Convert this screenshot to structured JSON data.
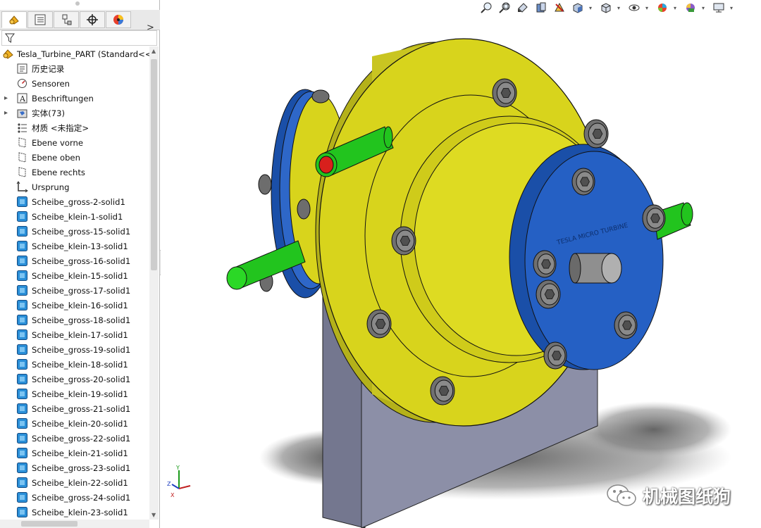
{
  "panel": {
    "tabs": [
      {
        "name": "feature-manager",
        "icon": "feature-tree-icon",
        "active": true
      },
      {
        "name": "property-manager",
        "icon": "property-list-icon",
        "active": false
      },
      {
        "name": "configuration-manager",
        "icon": "configuration-icon",
        "active": false
      },
      {
        "name": "dimxpert-manager",
        "icon": "crosshair-icon",
        "active": false
      },
      {
        "name": "display-manager",
        "icon": "appearance-icon",
        "active": false
      }
    ],
    "more_tabs_glyph": ">",
    "tree": {
      "root": {
        "label": "Tesla_Turbine_PART  (Standard<<"
      },
      "items": [
        {
          "label": "历史记录",
          "icon": "history-icon",
          "expandable": false
        },
        {
          "label": "Sensoren",
          "icon": "sensor-icon",
          "expandable": false
        },
        {
          "label": "Beschriftungen",
          "icon": "annotations-icon",
          "expandable": true
        },
        {
          "label": "实体(73)",
          "icon": "solid-bodies-folder-icon",
          "expandable": true
        },
        {
          "label": "材质 <未指定>",
          "icon": "material-icon",
          "expandable": false
        },
        {
          "label": "Ebene vorne",
          "icon": "plane-icon",
          "expandable": false
        },
        {
          "label": "Ebene oben",
          "icon": "plane-icon",
          "expandable": false
        },
        {
          "label": "Ebene rechts",
          "icon": "plane-icon",
          "expandable": false
        },
        {
          "label": "Ursprung",
          "icon": "origin-icon",
          "expandable": false
        },
        {
          "label": "Scheibe_gross-2-solid1",
          "icon": "imported-solid-icon",
          "expandable": false
        },
        {
          "label": "Scheibe_klein-1-solid1",
          "icon": "imported-solid-icon",
          "expandable": false
        },
        {
          "label": "Scheibe_gross-15-solid1",
          "icon": "imported-solid-icon",
          "expandable": false
        },
        {
          "label": "Scheibe_klein-13-solid1",
          "icon": "imported-solid-icon",
          "expandable": false
        },
        {
          "label": "Scheibe_gross-16-solid1",
          "icon": "imported-solid-icon",
          "expandable": false
        },
        {
          "label": "Scheibe_klein-15-solid1",
          "icon": "imported-solid-icon",
          "expandable": false
        },
        {
          "label": "Scheibe_gross-17-solid1",
          "icon": "imported-solid-icon",
          "expandable": false
        },
        {
          "label": "Scheibe_klein-16-solid1",
          "icon": "imported-solid-icon",
          "expandable": false
        },
        {
          "label": "Scheibe_gross-18-solid1",
          "icon": "imported-solid-icon",
          "expandable": false
        },
        {
          "label": "Scheibe_klein-17-solid1",
          "icon": "imported-solid-icon",
          "expandable": false
        },
        {
          "label": "Scheibe_gross-19-solid1",
          "icon": "imported-solid-icon",
          "expandable": false
        },
        {
          "label": "Scheibe_klein-18-solid1",
          "icon": "imported-solid-icon",
          "expandable": false
        },
        {
          "label": "Scheibe_gross-20-solid1",
          "icon": "imported-solid-icon",
          "expandable": false
        },
        {
          "label": "Scheibe_klein-19-solid1",
          "icon": "imported-solid-icon",
          "expandable": false
        },
        {
          "label": "Scheibe_gross-21-solid1",
          "icon": "imported-solid-icon",
          "expandable": false
        },
        {
          "label": "Scheibe_klein-20-solid1",
          "icon": "imported-solid-icon",
          "expandable": false
        },
        {
          "label": "Scheibe_gross-22-solid1",
          "icon": "imported-solid-icon",
          "expandable": false
        },
        {
          "label": "Scheibe_klein-21-solid1",
          "icon": "imported-solid-icon",
          "expandable": false
        },
        {
          "label": "Scheibe_gross-23-solid1",
          "icon": "imported-solid-icon",
          "expandable": false
        },
        {
          "label": "Scheibe_klein-22-solid1",
          "icon": "imported-solid-icon",
          "expandable": false
        },
        {
          "label": "Scheibe_gross-24-solid1",
          "icon": "imported-solid-icon",
          "expandable": false
        },
        {
          "label": "Scheibe_klein-23-solid1",
          "icon": "imported-solid-icon",
          "expandable": false
        }
      ]
    }
  },
  "heads_up_toolbar": [
    "zoom-to-fit-icon",
    "zoom-to-area-icon",
    "previous-view-icon",
    "section-view-icon",
    "dynamic-annotation-icon",
    "view-orientation-icon",
    "display-style-icon",
    "hide-show-items-icon",
    "edit-appearance-icon",
    "apply-scene-icon",
    "view-settings-icon"
  ],
  "triad": {
    "x": "X",
    "y": "Y",
    "z": "Z"
  },
  "model": {
    "colors": {
      "flange": "#d8d41c",
      "cover": "#1f5bc0",
      "pipe": "#22c41e",
      "pipe_inner": "#d8201c",
      "base": "#8c8fa7",
      "bolt": "#707070"
    }
  },
  "watermark": {
    "text": "机械图纸狗"
  }
}
